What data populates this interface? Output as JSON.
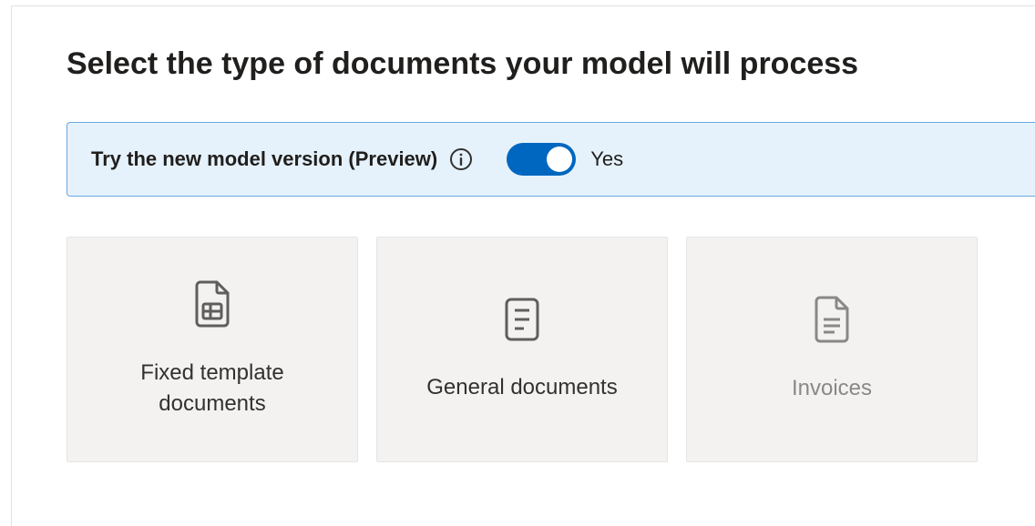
{
  "heading": "Select the type of documents your model will process",
  "previewBanner": {
    "label": "Try the new model version (Preview)",
    "toggleValue": "Yes"
  },
  "cards": [
    {
      "title": "Fixed template documents"
    },
    {
      "title": "General documents"
    },
    {
      "title": "Invoices"
    }
  ]
}
